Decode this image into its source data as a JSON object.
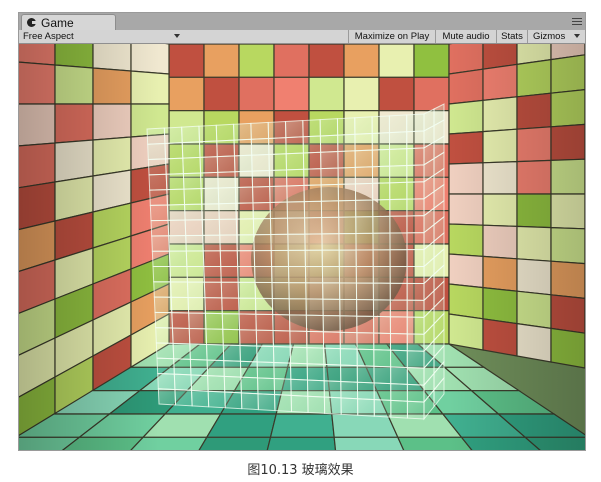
{
  "window": {
    "tab_title": "Game"
  },
  "toolbar": {
    "aspect_label": "Free Aspect",
    "maximize_label": "Maximize on Play",
    "mute_label": "Mute audio",
    "stats_label": "Stats",
    "gizmos_label": "Gizmos"
  },
  "scene": {
    "description_icon": "glass-cube-scene"
  },
  "caption": "图10.13  玻璃效果",
  "colors": {
    "tile_palette": [
      "#e8f0b0",
      "#b8d860",
      "#e07060",
      "#f0d0c0",
      "#c05040",
      "#e8a060",
      "#d0e890",
      "#f08070",
      "#90c040",
      "#f0e8d0"
    ],
    "floor_palette": [
      "#40b090",
      "#70d0a0",
      "#30a080",
      "#a0e0b0",
      "#5cc088",
      "#2e9a78",
      "#88d8b8"
    ]
  }
}
